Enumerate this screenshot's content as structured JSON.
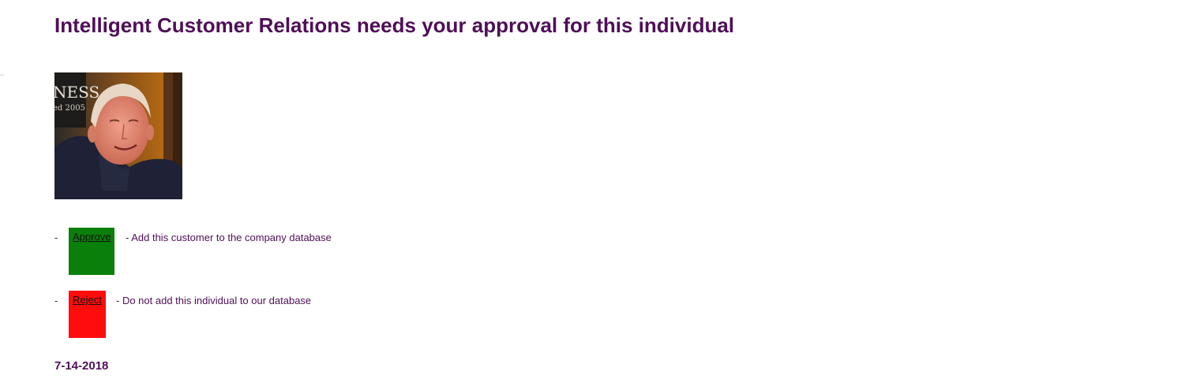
{
  "header": {
    "title": "Intelligent Customer Relations needs your approval for this individual"
  },
  "photo": {
    "sign_text_1": "NESS",
    "sign_text_2": "ed 2005"
  },
  "actions": {
    "bullet": "-",
    "approve": {
      "label": "Approve",
      "description": "- Add this customer to the company database",
      "color": "#0a800a"
    },
    "reject": {
      "label": "Reject",
      "description": "- Do not add this individual to our database",
      "color": "#ff0d0d"
    }
  },
  "footer": {
    "date": "7-14-2018"
  },
  "colors": {
    "text": "#4f0f57"
  }
}
